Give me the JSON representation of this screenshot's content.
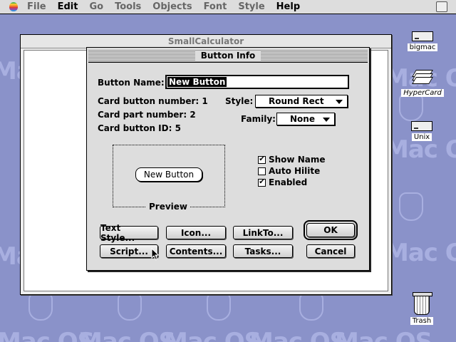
{
  "menubar": {
    "items": [
      "File",
      "Edit",
      "Go",
      "Tools",
      "Objects",
      "Font",
      "Style",
      "Help"
    ]
  },
  "desktop": {
    "watermark": "Mac OS",
    "icons": [
      {
        "label": "bigmac",
        "icon": "hard-drive-icon"
      },
      {
        "label": "HyperCard",
        "icon": "hypercard-stack-icon"
      },
      {
        "label": "Unix",
        "icon": "hard-drive-icon"
      },
      {
        "label": "Trash",
        "icon": "trash-icon"
      }
    ]
  },
  "window": {
    "title": "SmallCalculator"
  },
  "dialog": {
    "title": "Button Info",
    "button_name_label": "Button Name:",
    "button_name_value": "New Button",
    "card_button_number": "Card button number: 1",
    "card_part_number": "Card part number: 2",
    "card_button_id": "Card button ID: 5",
    "style_label": "Style:",
    "style_value": "Round Rect",
    "family_label": "Family:",
    "family_value": "None",
    "preview_button": "New Button",
    "preview_label": "Preview",
    "checkboxes": [
      {
        "label": "Show Name",
        "checked": true
      },
      {
        "label": "Auto Hilite",
        "checked": false
      },
      {
        "label": "Enabled",
        "checked": true
      }
    ],
    "buttons": {
      "text_style": "Text Style...",
      "icon": "Icon...",
      "link_to": "LinkTo...",
      "ok": "OK",
      "script": "Script...",
      "contents": "Contents...",
      "tasks": "Tasks...",
      "cancel": "Cancel"
    }
  }
}
